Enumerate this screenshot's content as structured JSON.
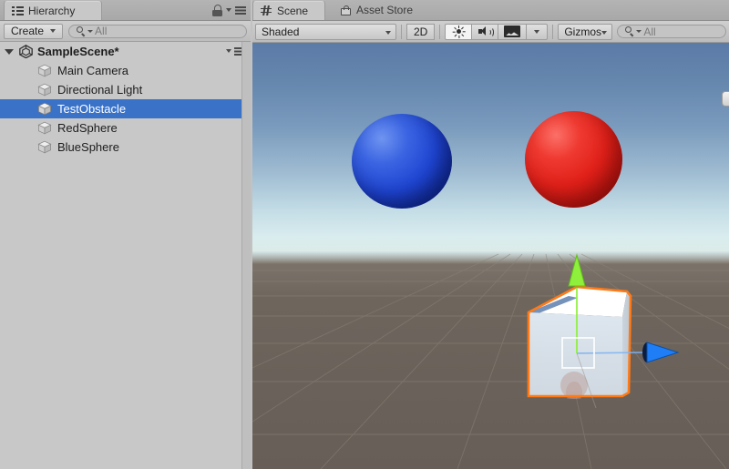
{
  "hierarchy": {
    "tab_label": "Hierarchy",
    "tab_icon": "hierarchy-list-icon",
    "lock_icon": "lock-icon",
    "menu_icon": "hamburger-menu-icon",
    "create_button": "Create",
    "create_caret": "chevron-down-icon",
    "search": {
      "icon": "search-icon",
      "value": "",
      "placeholder": "All"
    },
    "scene": {
      "name": "SampleScene*",
      "foldout": "expanded",
      "logo_icon": "unity-logo-icon",
      "row_menu_icon": "hamburger-menu-icon"
    },
    "items": [
      {
        "label": "Main Camera",
        "icon": "cube-gameobject-icon",
        "selected": false
      },
      {
        "label": "Directional Light",
        "icon": "cube-gameobject-icon",
        "selected": false
      },
      {
        "label": "TestObstacle",
        "icon": "cube-gameobject-icon",
        "selected": true
      },
      {
        "label": "RedSphere",
        "icon": "cube-gameobject-icon",
        "selected": false
      },
      {
        "label": "BlueSphere",
        "icon": "cube-gameobject-icon",
        "selected": false
      }
    ],
    "selection_color": "#3a72c8",
    "background_color": "#c8c8c8"
  },
  "scene_panel": {
    "tabs": [
      {
        "label": "Scene",
        "icon": "scene-grid-icon",
        "active": true
      },
      {
        "label": "Asset Store",
        "icon": "asset-store-bag-icon",
        "active": false
      }
    ],
    "toolbar": {
      "draw_mode": "Shaded",
      "draw_mode_caret": "chevron-down-icon",
      "two_d_button": "2D",
      "lighting_icon": "sun-lighting-icon",
      "lighting_on": true,
      "audio_icon": "speaker-audio-icon",
      "fx_icon": "image-effects-icon",
      "fx_caret": "chevron-down-icon",
      "gizmos_button": "Gizmos",
      "gizmos_caret": "chevron-down-icon",
      "search": {
        "icon": "search-icon",
        "value": "",
        "placeholder": "All"
      }
    },
    "viewport": {
      "sky_top_color": "#5c7ba8",
      "sky_horizon_color": "#dcebe7",
      "ground_color": "#6a625a",
      "grid_color": "#857d74",
      "objects": [
        {
          "name": "BlueSphere",
          "shape": "sphere",
          "color": "#1f45d2"
        },
        {
          "name": "RedSphere",
          "shape": "sphere",
          "color": "#e02019"
        },
        {
          "name": "TestObstacle",
          "shape": "cube",
          "color": "#dfe6ec",
          "selected": true,
          "outline_color": "#ff7a17"
        }
      ],
      "gizmo": {
        "type": "move-tool",
        "y_axis_color": "#8ef03b",
        "x_axis_color": "#1f7ef5",
        "center_handle": "white-square-handle"
      }
    }
  }
}
